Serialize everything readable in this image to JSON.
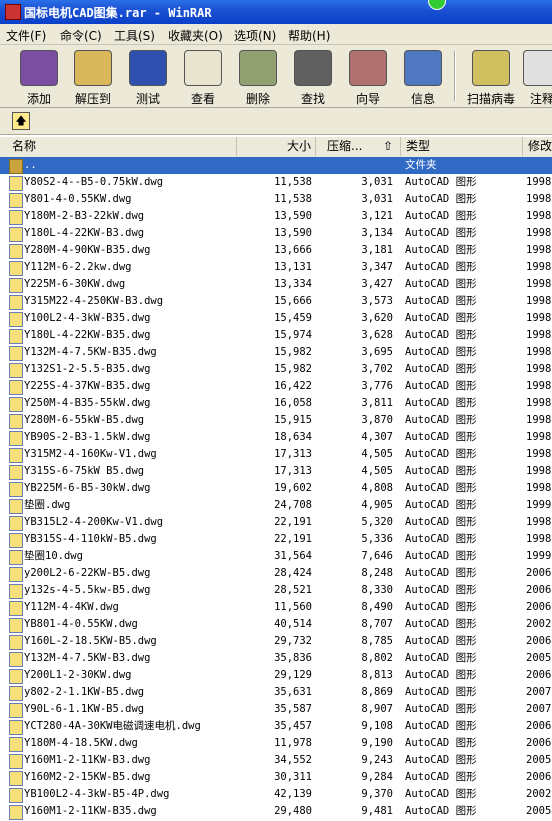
{
  "window": {
    "title": "国标电机CAD图集.rar - WinRAR"
  },
  "menu": [
    "文件(F)",
    "命令(C)",
    "工具(S)",
    "收藏夹(O)",
    "选项(N)",
    "帮助(H)"
  ],
  "toolbar": [
    {
      "label": "添加",
      "icon": "add-archive-icon",
      "color": "#7a4ea0"
    },
    {
      "label": "解压到",
      "icon": "extract-to-icon",
      "color": "#d8b85a"
    },
    {
      "label": "测试",
      "icon": "test-icon",
      "color": "#3050b0"
    },
    {
      "label": "查看",
      "icon": "view-icon",
      "color": "#e8e4d0"
    },
    {
      "label": "删除",
      "icon": "delete-icon",
      "color": "#90a070"
    },
    {
      "label": "查找",
      "icon": "find-icon",
      "color": "#606060"
    },
    {
      "label": "向导",
      "icon": "wizard-icon",
      "color": "#b07070"
    },
    {
      "label": "信息",
      "icon": "info-icon",
      "color": "#5078c0"
    },
    {
      "label": "扫描病毒",
      "icon": "virus-scan-icon",
      "color": "#d0c060"
    },
    {
      "label": "注释",
      "icon": "comment-icon",
      "color": "#e0e0e0"
    }
  ],
  "columns": {
    "name": "名称",
    "size": "大小",
    "packed": "压缩...",
    "type": "类型",
    "modified": "修改"
  },
  "parent_row": {
    "type": "文件夹"
  },
  "files": [
    [
      "Y80S2-4--B5-0.75kW.dwg",
      "11,538",
      "3,031",
      "AutoCAD 图形",
      "1998-"
    ],
    [
      "Y801-4-0.55KW.dwg",
      "11,538",
      "3,031",
      "AutoCAD 图形",
      "1998-"
    ],
    [
      "Y180M-2-B3-22kW.dwg",
      "13,590",
      "3,121",
      "AutoCAD 图形",
      "1998-"
    ],
    [
      "Y180L-4-22KW-B3.dwg",
      "13,590",
      "3,134",
      "AutoCAD 图形",
      "1998-"
    ],
    [
      "Y280M-4-90KW-B35.dwg",
      "13,666",
      "3,181",
      "AutoCAD 图形",
      "1998-"
    ],
    [
      "Y112M-6-2.2kw.dwg",
      "13,131",
      "3,347",
      "AutoCAD 图形",
      "1998-"
    ],
    [
      "Y225M-6-30KW.dwg",
      "13,334",
      "3,427",
      "AutoCAD 图形",
      "1998-"
    ],
    [
      "Y315M22-4-250KW-B3.dwg",
      "15,666",
      "3,573",
      "AutoCAD 图形",
      "1998-"
    ],
    [
      "Y100L2-4-3kW-B35.dwg",
      "15,459",
      "3,620",
      "AutoCAD 图形",
      "1998-"
    ],
    [
      "Y180L-4-22KW-B35.dwg",
      "15,974",
      "3,628",
      "AutoCAD 图形",
      "1998-"
    ],
    [
      "Y132M-4-7.5KW-B35.dwg",
      "15,982",
      "3,695",
      "AutoCAD 图形",
      "1998-"
    ],
    [
      "Y132S1-2-5.5-B35.dwg",
      "15,982",
      "3,702",
      "AutoCAD 图形",
      "1998-"
    ],
    [
      "Y225S-4-37KW-B35.dwg",
      "16,422",
      "3,776",
      "AutoCAD 图形",
      "1998-"
    ],
    [
      "Y250M-4-B35-55kW.dwg",
      "16,058",
      "3,811",
      "AutoCAD 图形",
      "1998-"
    ],
    [
      "Y280M-6-55kW-B5.dwg",
      "15,915",
      "3,870",
      "AutoCAD 图形",
      "1998-"
    ],
    [
      "YB90S-2-B3-1.5kW.dwg",
      "18,634",
      "4,307",
      "AutoCAD 图形",
      "1998-"
    ],
    [
      "Y315M2-4-160Kw-V1.dwg",
      "17,313",
      "4,505",
      "AutoCAD 图形",
      "1998-"
    ],
    [
      "Y315S-6-75kW B5.dwg",
      "17,313",
      "4,505",
      "AutoCAD 图形",
      "1998-"
    ],
    [
      "YB225M-6-B5-30kW.dwg",
      "19,602",
      "4,808",
      "AutoCAD 图形",
      "1998-"
    ],
    [
      "垫圈.dwg",
      "24,708",
      "4,905",
      "AutoCAD 图形",
      "1999-"
    ],
    [
      "YB315L2-4-200Kw-V1.dwg",
      "22,191",
      "5,320",
      "AutoCAD 图形",
      "1998-"
    ],
    [
      "YB315S-4-110kW-B5.dwg",
      "22,191",
      "5,336",
      "AutoCAD 图形",
      "1998-"
    ],
    [
      "垫圈10.dwg",
      "31,564",
      "7,646",
      "AutoCAD 图形",
      "1999-"
    ],
    [
      "y200L2-6-22KW-B5.dwg",
      "28,424",
      "8,248",
      "AutoCAD 图形",
      "2006-"
    ],
    [
      "y132s-4-5.5kw-B5.dwg",
      "28,521",
      "8,330",
      "AutoCAD 图形",
      "2006-"
    ],
    [
      "Y112M-4-4KW.dwg",
      "11,560",
      "8,490",
      "AutoCAD 图形",
      "2006-"
    ],
    [
      "YB801-4-0.55KW.dwg",
      "40,514",
      "8,707",
      "AutoCAD 图形",
      "2002-"
    ],
    [
      "Y160L-2-18.5KW-B5.dwg",
      "29,732",
      "8,785",
      "AutoCAD 图形",
      "2006-"
    ],
    [
      "Y132M-4-7.5KW-B3.dwg",
      "35,836",
      "8,802",
      "AutoCAD 图形",
      "2005-"
    ],
    [
      "Y200L1-2-30KW.dwg",
      "29,129",
      "8,813",
      "AutoCAD 图形",
      "2006-"
    ],
    [
      "y802-2-1.1KW-B5.dwg",
      "35,631",
      "8,869",
      "AutoCAD 图形",
      "2007-"
    ],
    [
      "Y90L-6-1.1KW-B5.dwg",
      "35,587",
      "8,907",
      "AutoCAD 图形",
      "2007-"
    ],
    [
      "YCT280-4A-30KW电磁调速电机.dwg",
      "35,457",
      "9,108",
      "AutoCAD 图形",
      "2006-"
    ],
    [
      "Y180M-4-18.5KW.dwg",
      "11,978",
      "9,190",
      "AutoCAD 图形",
      "2006-"
    ],
    [
      "Y160M1-2-11KW-B3.dwg",
      "34,552",
      "9,243",
      "AutoCAD 图形",
      "2005-"
    ],
    [
      "Y160M2-2-15KW-B5.dwg",
      "30,311",
      "9,284",
      "AutoCAD 图形",
      "2006-"
    ],
    [
      "YB100L2-4-3kW-B5-4P.dwg",
      "42,139",
      "9,370",
      "AutoCAD 图形",
      "2002-"
    ],
    [
      "Y160M1-2-11KW-B35.dwg",
      "29,480",
      "9,481",
      "AutoCAD 图形",
      "2005-"
    ]
  ]
}
